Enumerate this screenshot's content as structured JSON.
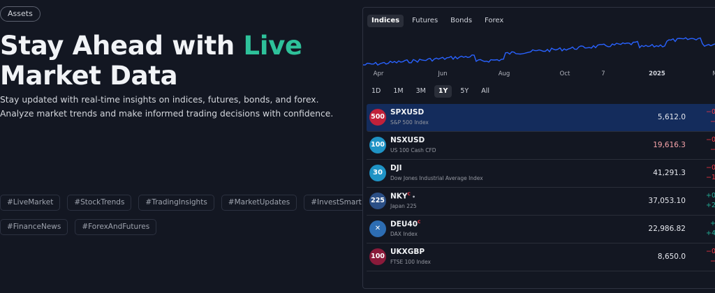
{
  "hero": {
    "badge": "Assets",
    "title_part1": "Stay Ahead with ",
    "title_accent": "Live",
    "title_part2": "Market Data",
    "description": "Stay updated with real-time insights on indices, futures, bonds, and forex. Analyze market trends and make informed trading decisions with confidence.",
    "tags_row1": [
      "#LiveMarket",
      "#StockTrends",
      "#TradingInsights",
      "#MarketUpdates",
      "#InvestSmart"
    ],
    "tags_row2": [
      "#FinanceNews",
      "#ForexAndFutures"
    ],
    "accent_color": "#2ec19a"
  },
  "widget": {
    "tabs": [
      {
        "label": "Indices",
        "active": true
      },
      {
        "label": "Futures",
        "active": false
      },
      {
        "label": "Bonds",
        "active": false
      },
      {
        "label": "Forex",
        "active": false
      }
    ],
    "x_axis_labels": [
      "Apr",
      "Jun",
      "Aug",
      "Oct",
      "7",
      "2025",
      "M"
    ],
    "ranges": [
      {
        "label": "1D",
        "active": false
      },
      {
        "label": "1M",
        "active": false
      },
      {
        "label": "3M",
        "active": false
      },
      {
        "label": "1Y",
        "active": true
      },
      {
        "label": "5Y",
        "active": false
      },
      {
        "label": "All",
        "active": false
      }
    ],
    "line_color": "#2962ff",
    "rows": [
      {
        "logo": "500",
        "logo_color": "#c1213a",
        "symbol": "SPXUSD",
        "description": "S&P 500 Index",
        "price": "5,612.0",
        "price_down": false,
        "chg1": "−0",
        "chg2": "−",
        "chg_sign": "neg",
        "selected": true
      },
      {
        "logo": "100",
        "logo_color": "#1f93c5",
        "symbol": "NSXUSD",
        "description": "US 100 Cash CFD",
        "price": "19,616.3",
        "price_down": true,
        "chg1": "−0",
        "chg2": "−",
        "chg_sign": "neg",
        "selected": false
      },
      {
        "logo": "30",
        "logo_color": "#1f93c5",
        "symbol": "DJI",
        "description": "Dow Jones Industrial Average Index",
        "price": "41,291.3",
        "price_down": false,
        "chg1": "−0",
        "chg2": "−1",
        "chg_sign": "neg",
        "selected": false
      },
      {
        "logo": "225",
        "logo_color": "#2b4f86",
        "symbol": "NKY",
        "description": "Japan 225",
        "price": "37,053.10",
        "price_down": false,
        "chg1": "+0",
        "chg2": "+2",
        "chg_sign": "pos",
        "selected": false,
        "sup": "C",
        "dot": "•"
      },
      {
        "logo": "✕",
        "logo_color": "#2d6db3",
        "symbol": "DEU40",
        "description": "DAX Index",
        "price": "22,986.82",
        "price_down": false,
        "chg1": "+",
        "chg2": "+4",
        "chg_sign": "pos",
        "selected": false,
        "sup": "C"
      },
      {
        "logo": "100",
        "logo_color": "#8a1a3a",
        "symbol": "UKXGBP",
        "description": "FTSE 100 Index",
        "price": "8,650.0",
        "price_down": false,
        "chg1": "−0",
        "chg2": "−",
        "chg_sign": "neg",
        "selected": false
      }
    ]
  }
}
